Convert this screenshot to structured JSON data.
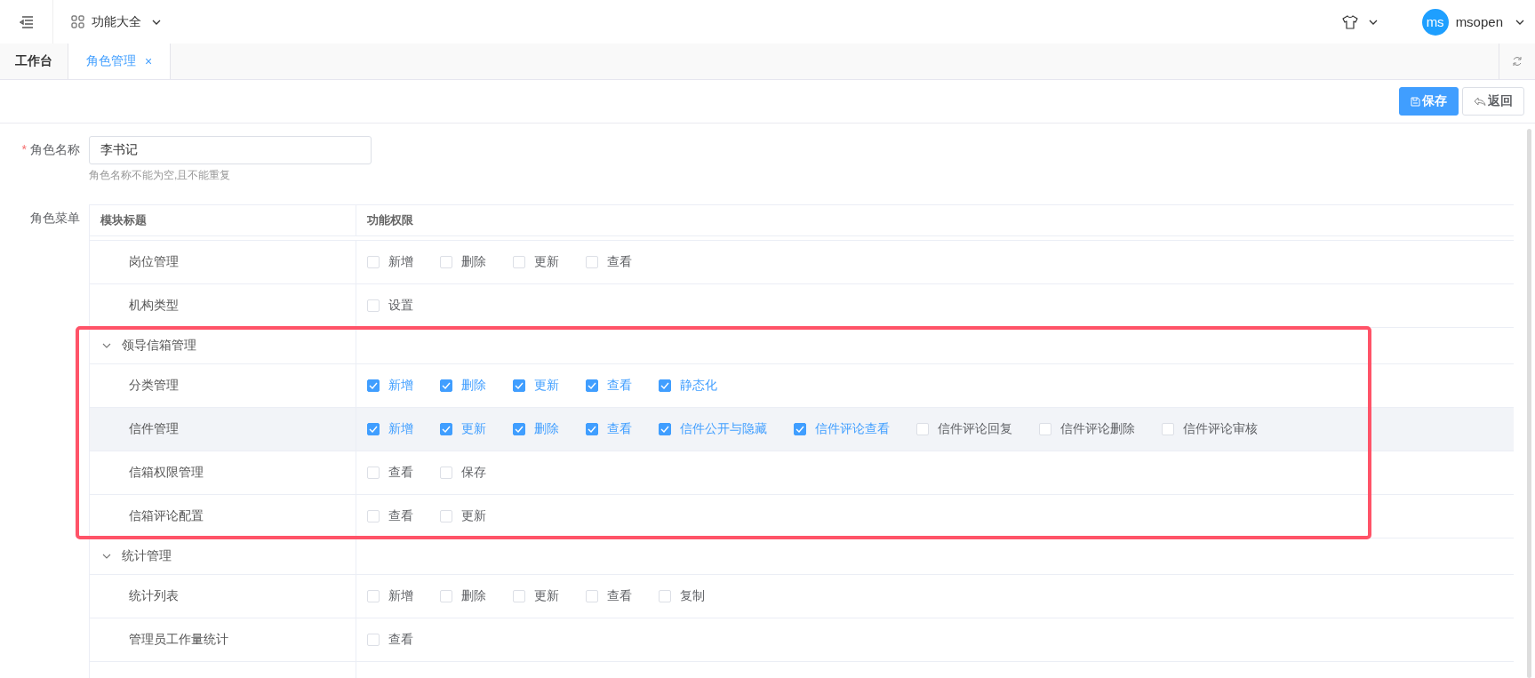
{
  "header": {
    "menu_title": "功能大全",
    "user": {
      "avatar_text": "ms",
      "name": "msopen"
    }
  },
  "tabs": [
    {
      "label": "工作台",
      "selected": false
    },
    {
      "label": "角色管理",
      "selected": true,
      "close_glyph": "×"
    }
  ],
  "toolbar": {
    "buttons": [
      {
        "label": "保存",
        "kind": "primary"
      },
      {
        "label": "返回",
        "kind": "default"
      }
    ]
  },
  "form": {
    "name_label": "角色名称",
    "required_mark": "*",
    "name_value": "李书记",
    "name_hint": "角色名称不能为空,且不能重复",
    "menu_label": "角色菜单"
  },
  "table": {
    "columns": [
      "模块标题",
      "功能权限"
    ],
    "rows": [
      {
        "children": [
          {
            "title": "岗位管理",
            "highlighted": false,
            "permissions": [
              {
                "label": "新增",
                "checked": false
              },
              {
                "label": "删除",
                "checked": false
              },
              {
                "label": "更新",
                "checked": false
              },
              {
                "label": "查看",
                "checked": false
              }
            ]
          },
          {
            "title": "机构类型",
            "highlighted": false,
            "permissions": [
              {
                "label": "设置",
                "checked": false
              }
            ]
          }
        ]
      },
      {
        "title": "领导信箱管理",
        "expanded": true,
        "children": [
          {
            "title": "分类管理",
            "highlighted": false,
            "permissions": [
              {
                "label": "新增",
                "checked": true
              },
              {
                "label": "删除",
                "checked": true
              },
              {
                "label": "更新",
                "checked": true
              },
              {
                "label": "查看",
                "checked": true
              },
              {
                "label": "静态化",
                "checked": true
              }
            ]
          },
          {
            "title": "信件管理",
            "highlighted": true,
            "permissions": [
              {
                "label": "新增",
                "checked": true
              },
              {
                "label": "更新",
                "checked": true
              },
              {
                "label": "删除",
                "checked": true
              },
              {
                "label": "查看",
                "checked": true
              },
              {
                "label": "信件公开与隐藏",
                "checked": true
              },
              {
                "label": "信件评论查看",
                "checked": true
              },
              {
                "label": "信件评论回复",
                "checked": false
              },
              {
                "label": "信件评论删除",
                "checked": false
              },
              {
                "label": "信件评论审核",
                "checked": false
              }
            ]
          },
          {
            "title": "信箱权限管理",
            "highlighted": false,
            "permissions": [
              {
                "label": "查看",
                "checked": false
              },
              {
                "label": "保存",
                "checked": false
              }
            ]
          },
          {
            "title": "信箱评论配置",
            "highlighted": false,
            "permissions": [
              {
                "label": "查看",
                "checked": false
              },
              {
                "label": "更新",
                "checked": false
              }
            ]
          }
        ]
      },
      {
        "title": "统计管理",
        "expanded": true,
        "children": [
          {
            "title": "统计列表",
            "highlighted": false,
            "permissions": [
              {
                "label": "新增",
                "checked": false
              },
              {
                "label": "删除",
                "checked": false
              },
              {
                "label": "更新",
                "checked": false
              },
              {
                "label": "查看",
                "checked": false
              },
              {
                "label": "复制",
                "checked": false
              }
            ]
          },
          {
            "title": "管理员工作量统计",
            "highlighted": false,
            "permissions": [
              {
                "label": "查看",
                "checked": false
              }
            ]
          }
        ]
      }
    ]
  },
  "annotation": {
    "kind": "highlight-frame"
  }
}
